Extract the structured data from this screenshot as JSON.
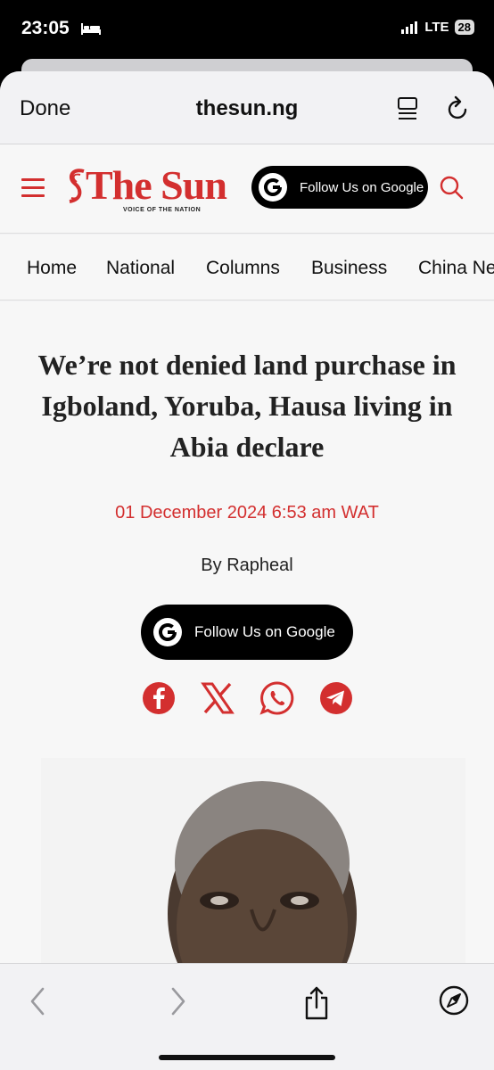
{
  "status": {
    "time": "23:05",
    "network": "LTE",
    "battery": "28"
  },
  "browser": {
    "done_label": "Done",
    "url": "thesun.ng"
  },
  "site": {
    "logo_text": "The Sun",
    "logo_tagline": "VOICE OF THE NATION",
    "follow_label": "Follow Us on Google",
    "brand_color": "#d32f2f"
  },
  "nav": {
    "items": [
      "Home",
      "National",
      "Columns",
      "Business",
      "China News"
    ]
  },
  "article": {
    "headline": "We’re not denied land purchase in Igboland, Yoruba, Hausa living in Abia declare",
    "date": "01 December 2024 6:53 am WAT",
    "byline": "By Rapheal",
    "follow_label": "Follow Us on Google",
    "share": [
      "facebook-icon",
      "x-icon",
      "whatsapp-icon",
      "telegram-icon"
    ]
  },
  "bottom_bar": [
    "back-icon",
    "forward-icon",
    "share-icon",
    "compass-icon"
  ]
}
